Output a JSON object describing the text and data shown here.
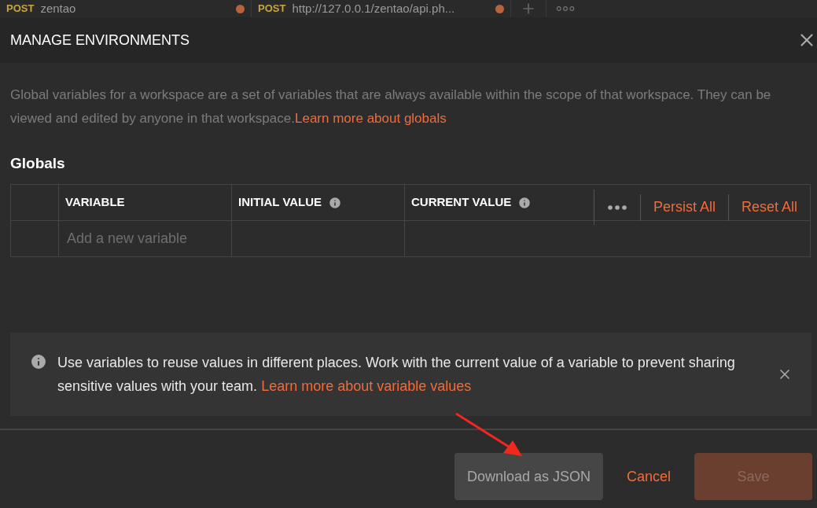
{
  "tabs": [
    {
      "method": "POST",
      "title": "zentao",
      "unsaved": true
    },
    {
      "method": "POST",
      "title": "http://127.0.0.1/zentao/api.ph...",
      "unsaved": true
    }
  ],
  "modal": {
    "title": "MANAGE ENVIRONMENTS",
    "description": "Global variables for a workspace are a set of variables that are always available within the scope of that workspace. They can be viewed and edited by anyone in that workspace.",
    "description_link": "Learn more about globals",
    "section_title": "Globals",
    "table": {
      "columns": [
        {
          "label": "VARIABLE",
          "info": false
        },
        {
          "label": "INITIAL VALUE",
          "info": true
        },
        {
          "label": "CURRENT VALUE",
          "info": true
        }
      ],
      "actions": [
        "Persist All",
        "Reset All"
      ],
      "new_row": {
        "placeholder": "Add a new variable"
      }
    },
    "banner": {
      "text": "Use variables to reuse values in different places. Work with the current value of a variable to prevent sharing sensitive values with your team.",
      "link": "Learn more about variable values"
    },
    "buttons": [
      {
        "label": "Download as JSON",
        "kind": "secondary",
        "disabled": false
      },
      {
        "label": "Cancel",
        "kind": "link",
        "disabled": false
      },
      {
        "label": "Save",
        "kind": "primary",
        "disabled": true
      }
    ]
  }
}
